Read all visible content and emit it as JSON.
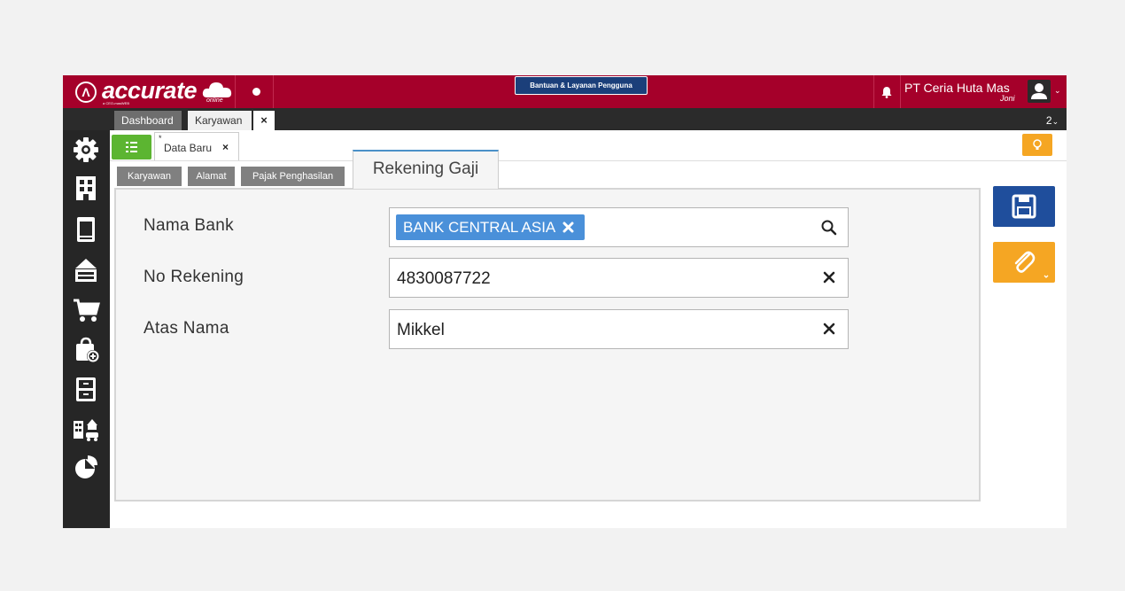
{
  "topbar": {
    "logo_text": "accurate",
    "logo_sub": "online",
    "logo_tagline": "a CEO-masWEB",
    "help_label": "Bantuan & Layanan Pengguna",
    "company": "PT Ceria Huta Mas",
    "user": "Joni",
    "brand_color": "#a5002a"
  },
  "tabs": {
    "dashboard": "Dashboard",
    "karyawan": "Karyawan",
    "close": "×",
    "count": "2"
  },
  "subtab": {
    "asterisk": "*",
    "label": "Data Baru",
    "close": "×"
  },
  "form_tabs": {
    "karyawan": "Karyawan",
    "alamat": "Alamat",
    "pajak": "Pajak Penghasilan",
    "rekening": "Rekening Gaji"
  },
  "fields": {
    "nama_bank": {
      "label": "Nama Bank",
      "value": "BANK CENTRAL ASIA"
    },
    "no_rekening": {
      "label": "No Rekening",
      "value": "4830087722"
    },
    "atas_nama": {
      "label": "Atas Nama",
      "value": "Mikkel"
    }
  },
  "sidebar_icons": [
    "settings-icon",
    "company-icon",
    "ledger-icon",
    "cash-icon",
    "cart-icon",
    "purchase-bag-icon",
    "inventory-icon",
    "assets-icon",
    "report-pie-icon"
  ],
  "accent": {
    "save": "#1f4e9c",
    "attach": "#f5a623",
    "list": "#5cb531",
    "chip": "#4a90d9"
  }
}
